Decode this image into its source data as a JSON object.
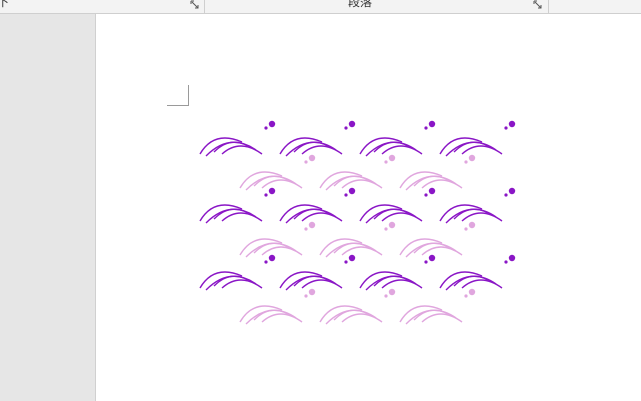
{
  "ribbon": {
    "group_left_label": "下",
    "group_paragraph_label": "段落"
  },
  "icons": {
    "launcher": "dialog-launcher-icon"
  },
  "colors": {
    "dark_purple": "#8a16c6",
    "light_purple": "#e0a6de",
    "gutter": "#e6e6e6",
    "ribbon": "#f3f3f3"
  },
  "pattern": {
    "rows_dark": 3,
    "motifs_per_row": 4
  }
}
